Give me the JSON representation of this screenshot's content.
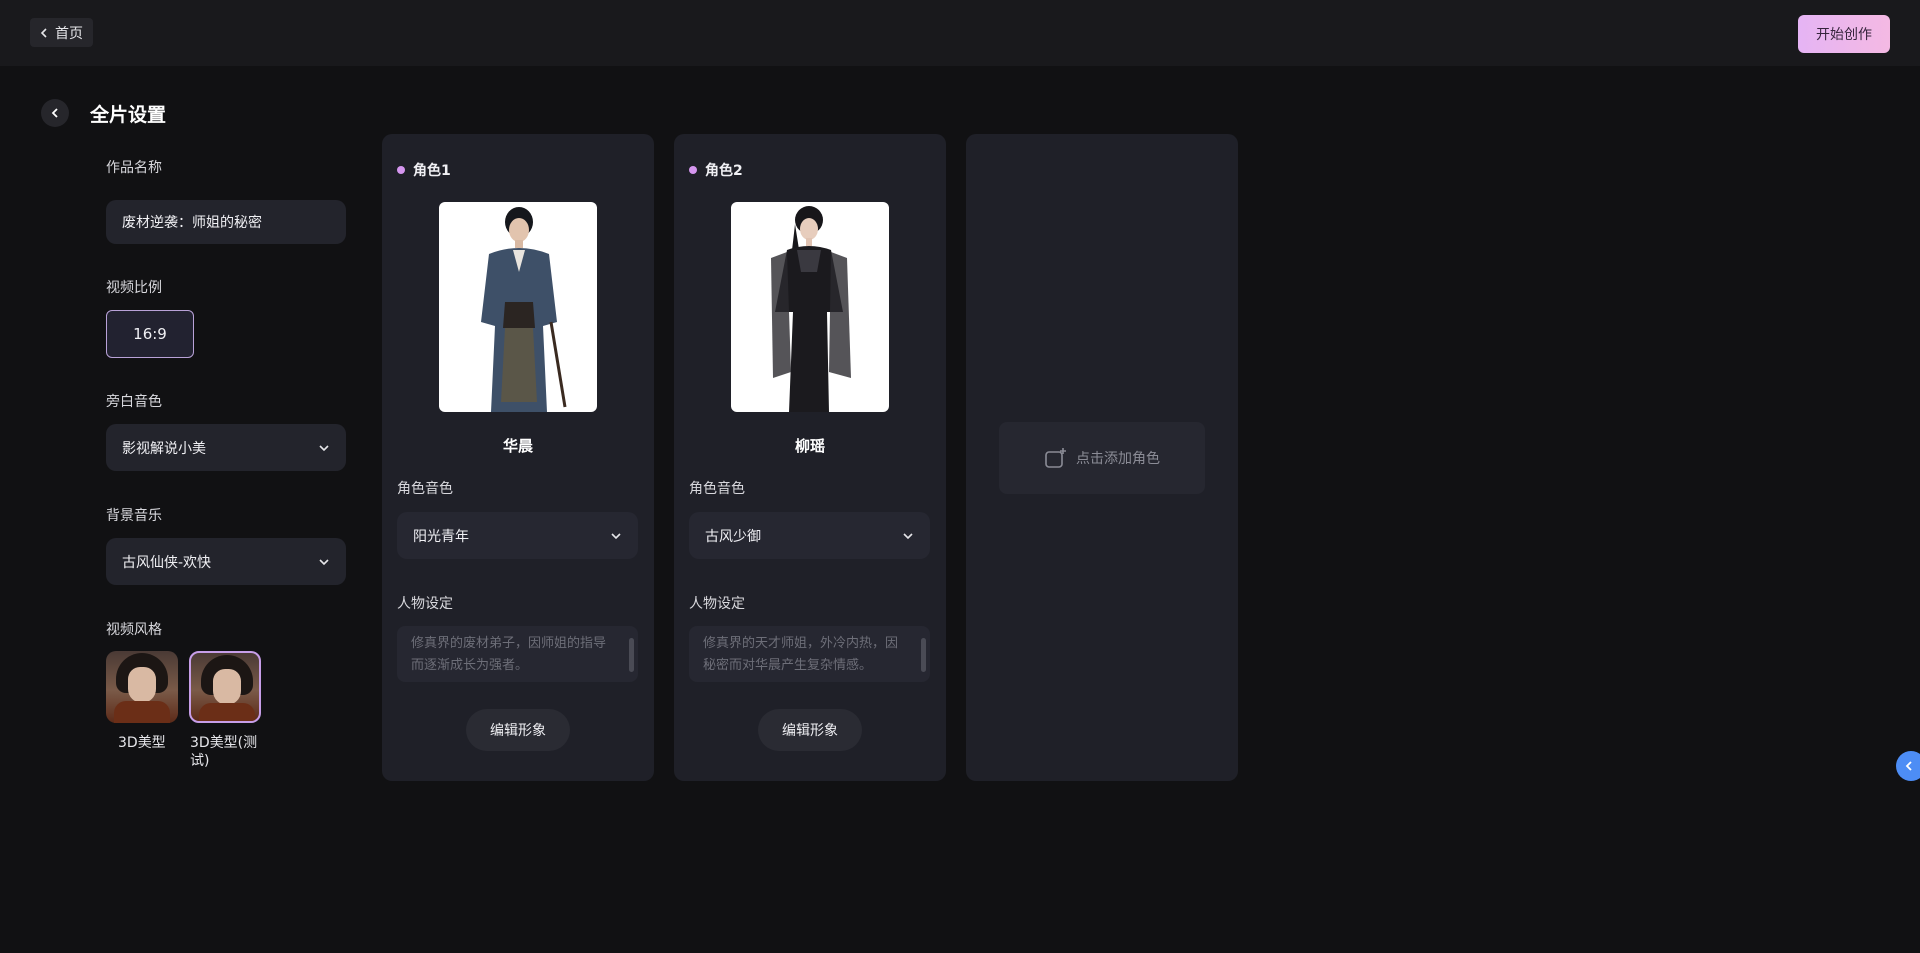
{
  "header": {
    "home_label": "首页",
    "start_button": "开始创作"
  },
  "page": {
    "title": "全片设置"
  },
  "settings": {
    "work_name_label": "作品名称",
    "work_name_value": "废材逆袭：师姐的秘密",
    "aspect_label": "视频比例",
    "aspect_value": "16:9",
    "narrator_label": "旁白音色",
    "narrator_value": "影视解说小美",
    "bgm_label": "背景音乐",
    "bgm_value": "古风仙侠-欢快",
    "style_label": "视频风格",
    "styles": [
      {
        "name": "3D美型",
        "selected": false
      },
      {
        "name": "3D美型(测试)",
        "selected": true
      }
    ]
  },
  "characters": [
    {
      "title": "角色1",
      "name": "华晨",
      "voice_label": "角色音色",
      "voice_value": "阳光青年",
      "persona_label": "人物设定",
      "persona_text": "修真界的废材弟子，因师姐的指导而逐渐成长为强者。",
      "edit_label": "编辑形象"
    },
    {
      "title": "角色2",
      "name": "柳瑶",
      "voice_label": "角色音色",
      "voice_value": "古风少御",
      "persona_label": "人物设定",
      "persona_text": "修真界的天才师姐，外冷内热，因秘密而对华晨产生复杂情感。",
      "edit_label": "编辑形象"
    }
  ],
  "add_character_label": "点击添加角色",
  "colors": {
    "accent": "#d596ef",
    "start_gradient_from": "#e5b4f4",
    "start_gradient_to": "#f4b9e3",
    "side_tab": "#4d8df5"
  }
}
